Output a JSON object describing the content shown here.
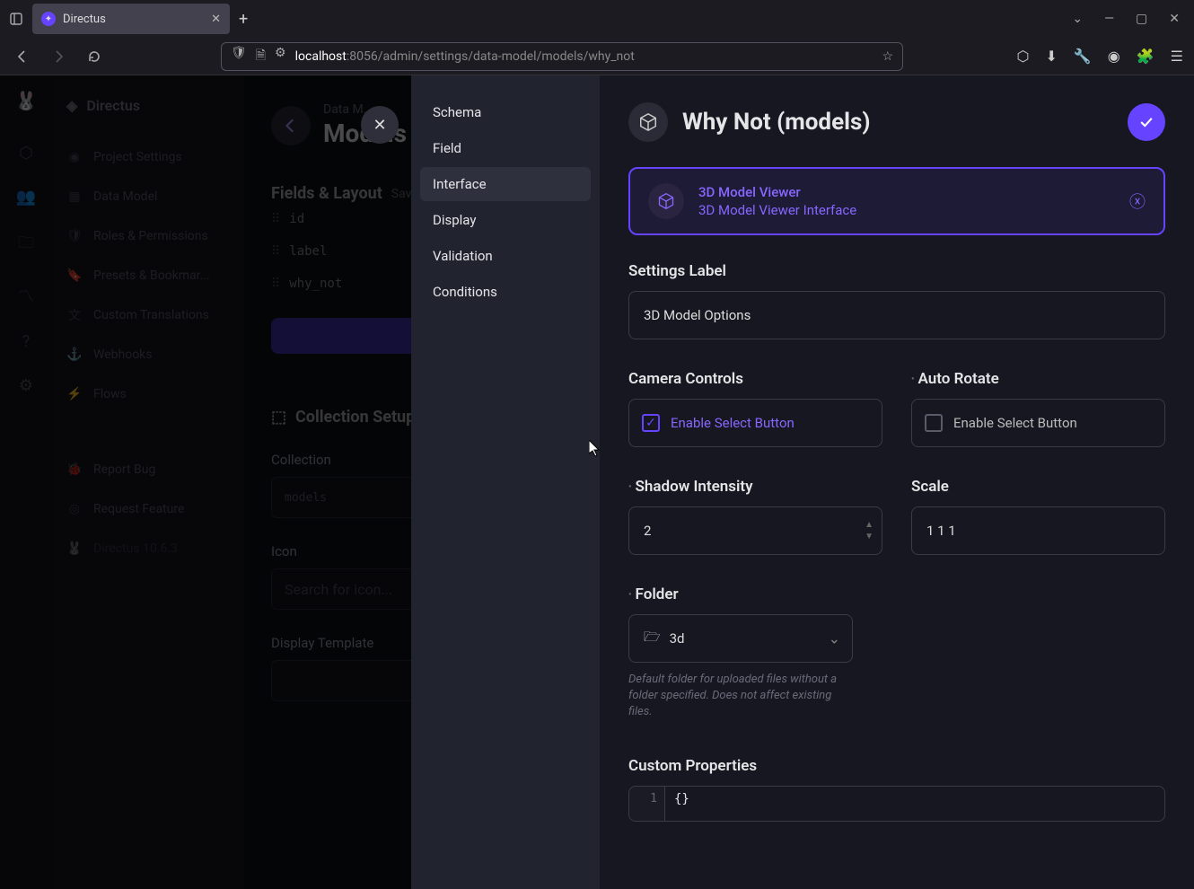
{
  "browser": {
    "tab_title": "Directus",
    "url_host": "localhost",
    "url_port": ":8056",
    "url_path": "/admin/settings/data-model/models/why_not"
  },
  "sidebar": {
    "brand": "Directus",
    "items": [
      {
        "label": "Project Settings"
      },
      {
        "label": "Data Model"
      },
      {
        "label": "Roles & Permissions"
      },
      {
        "label": "Presets & Bookmar..."
      },
      {
        "label": "Custom Translations"
      },
      {
        "label": "Webhooks"
      },
      {
        "label": "Flows"
      }
    ],
    "extras": [
      {
        "label": "Report Bug"
      },
      {
        "label": "Request Feature"
      },
      {
        "label": "Directus 10.6.3"
      }
    ]
  },
  "main": {
    "crumb": "Data M...",
    "title": "Models",
    "fields_heading": "Fields & Layout",
    "save": "Save",
    "fields": [
      "id",
      "label",
      "why_not"
    ],
    "collection_setup": "Collection Setup",
    "collection_label": "Collection",
    "collection_value": "models",
    "icon_label": "Icon",
    "icon_placeholder": "Search for icon...",
    "display_template_label": "Display Template"
  },
  "drawer": {
    "nav": [
      "Schema",
      "Field",
      "Interface",
      "Display",
      "Validation",
      "Conditions"
    ],
    "active_index": 2,
    "title": "Why Not (models)",
    "selected": {
      "line1": "3D Model Viewer",
      "line2": "3D Model Viewer Interface"
    },
    "settings_label_label": "Settings Label",
    "settings_label_value": "3D Model Options",
    "camera_controls_label": "Camera Controls",
    "camera_controls_text": "Enable Select Button",
    "auto_rotate_label": "Auto Rotate",
    "auto_rotate_text": "Enable Select Button",
    "shadow_intensity_label": "Shadow Intensity",
    "shadow_intensity_value": "2",
    "scale_label": "Scale",
    "scale_value": "1 1 1",
    "folder_label": "Folder",
    "folder_value": "3d",
    "folder_help": "Default folder for uploaded files without a folder specified. Does not affect existing files.",
    "custom_props_label": "Custom Properties",
    "code_line": "1",
    "code_value": "{}"
  }
}
